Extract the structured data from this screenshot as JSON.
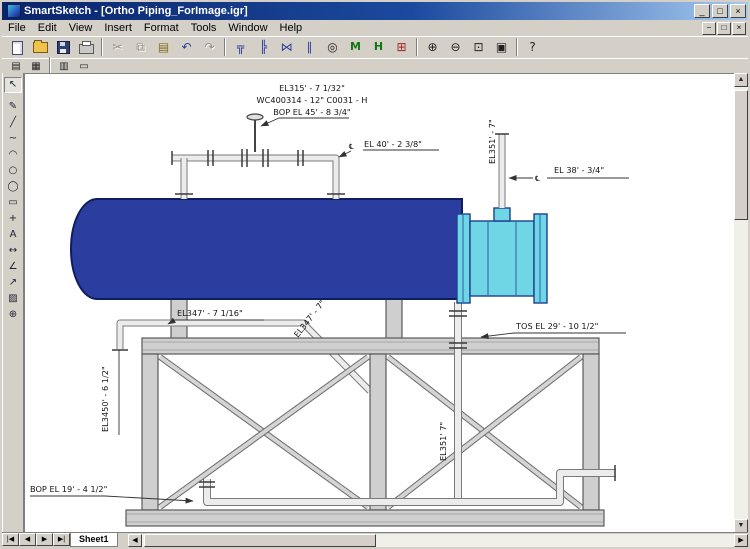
{
  "window": {
    "title": "SmartSketch - [Ortho Piping_ForImage.igr]",
    "controls": {
      "minimize": "_",
      "maximize": "□",
      "close": "×"
    }
  },
  "menu_bar": {
    "items": [
      "File",
      "Edit",
      "View",
      "Insert",
      "Format",
      "Tools",
      "Window",
      "Help"
    ],
    "mdi": {
      "minimize": "−",
      "restore": "□",
      "close": "×"
    }
  },
  "toolbar_main": {
    "cut": "✂",
    "copy": "⧉",
    "paste": "▤",
    "undo": "↶",
    "redo": "↷",
    "route_pipe": "╦",
    "branch": "╠",
    "valve": "⋈",
    "flange": "∥",
    "instrument": "◎",
    "tag_m": "M",
    "tag_h": "H",
    "grid": "⊞",
    "zoom_in": "⊕",
    "zoom_out": "⊖",
    "zoom_area": "⊡",
    "zoom_fit": "▣",
    "help": "?"
  },
  "toolbar_secondary": {
    "sheet_setup": "▤",
    "layers": "▦",
    "preview": "▥",
    "frame": "▭"
  },
  "tool_palette": {
    "select": "↖",
    "sketch": "✎",
    "line": "╱",
    "curve": "~",
    "arc": "◠",
    "circle": "○",
    "ellipse": "◯",
    "rectangle": "▭",
    "point": "+",
    "text": "A",
    "dimension": "↔",
    "angle": "∠",
    "leader": "↗",
    "hatch": "▨",
    "zoom": "⊕"
  },
  "drawing": {
    "labels": {
      "top_line1": "EL315' - 7 1/32\"",
      "top_line2": "WC400314 - 12\" C0031 - H",
      "top_line3": "BOP EL 45' - 8 3/4\"",
      "el40": "EL 40' - 2 3/8\"",
      "el38": "EL 38' - 3/4\"",
      "el351_riser": "EL351' - 7\"",
      "el347_horiz": "EL347' - 7 1/16\"",
      "el347_diag": "EL347' - 7\"",
      "el3450": "EL3450' - 6 1/2\"",
      "tos": "TOS EL 29' - 10 1/2\"",
      "el351_drop": "EL351' 7\"",
      "bop19": "BOP EL 19' - 4 1/2\"",
      "centerline": "℄"
    },
    "colors": {
      "vessel": "#2b3ea0",
      "vessel_outline": "#0f1e5c",
      "spool": "#6fd6e6",
      "spool_outline": "#1d3f8f",
      "steel": "#cfcfcf",
      "steel_outline": "#5a5a5a",
      "pipe_fill": "#ececec",
      "pipe_outline": "#7a7a7a"
    }
  },
  "sheet_bar": {
    "nav_first": "|◀",
    "nav_prev": "◀",
    "nav_next": "▶",
    "nav_last": "▶|",
    "active_tab": "Sheet1"
  },
  "scrollbar": {
    "up": "▲",
    "down": "▼",
    "left": "◀",
    "right": "▶"
  }
}
